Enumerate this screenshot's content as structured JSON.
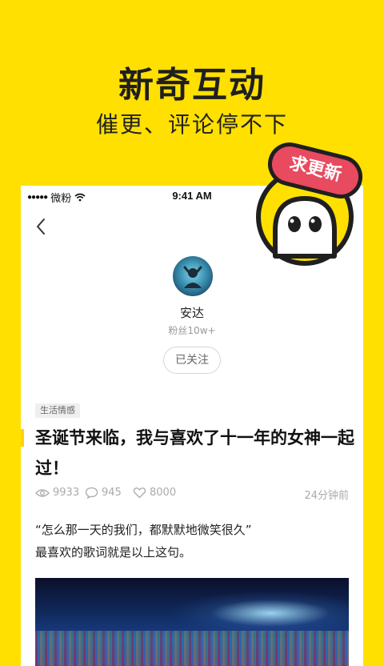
{
  "promo": {
    "title": "新奇互动",
    "subtitle": "催更、评论停不下"
  },
  "badge": {
    "label": "求更新"
  },
  "status_bar": {
    "dots": "●●●●●",
    "carrier": "微粉",
    "time": "9:41 AM"
  },
  "author": {
    "name": "安达",
    "followers": "粉丝10w+",
    "follow_label": "已关注"
  },
  "article": {
    "tag": "生活情感",
    "title": "圣诞节来临，我与喜欢了十一年的女神一起过！",
    "views": "9933",
    "comments": "945",
    "likes": "8000",
    "time_ago": "24分钟前",
    "paragraphs": [
      "“怎么那一天的我们，都默默地微笑很久”",
      "最喜欢的歌词就是以上这句。"
    ]
  },
  "colors": {
    "background": "#FFE000",
    "badge": "#E84A5F",
    "accent_bar": "#FFD400"
  },
  "icons": [
    "back-icon",
    "eye-icon",
    "comment-icon",
    "heart-icon",
    "wifi-icon",
    "mascot-icon"
  ]
}
